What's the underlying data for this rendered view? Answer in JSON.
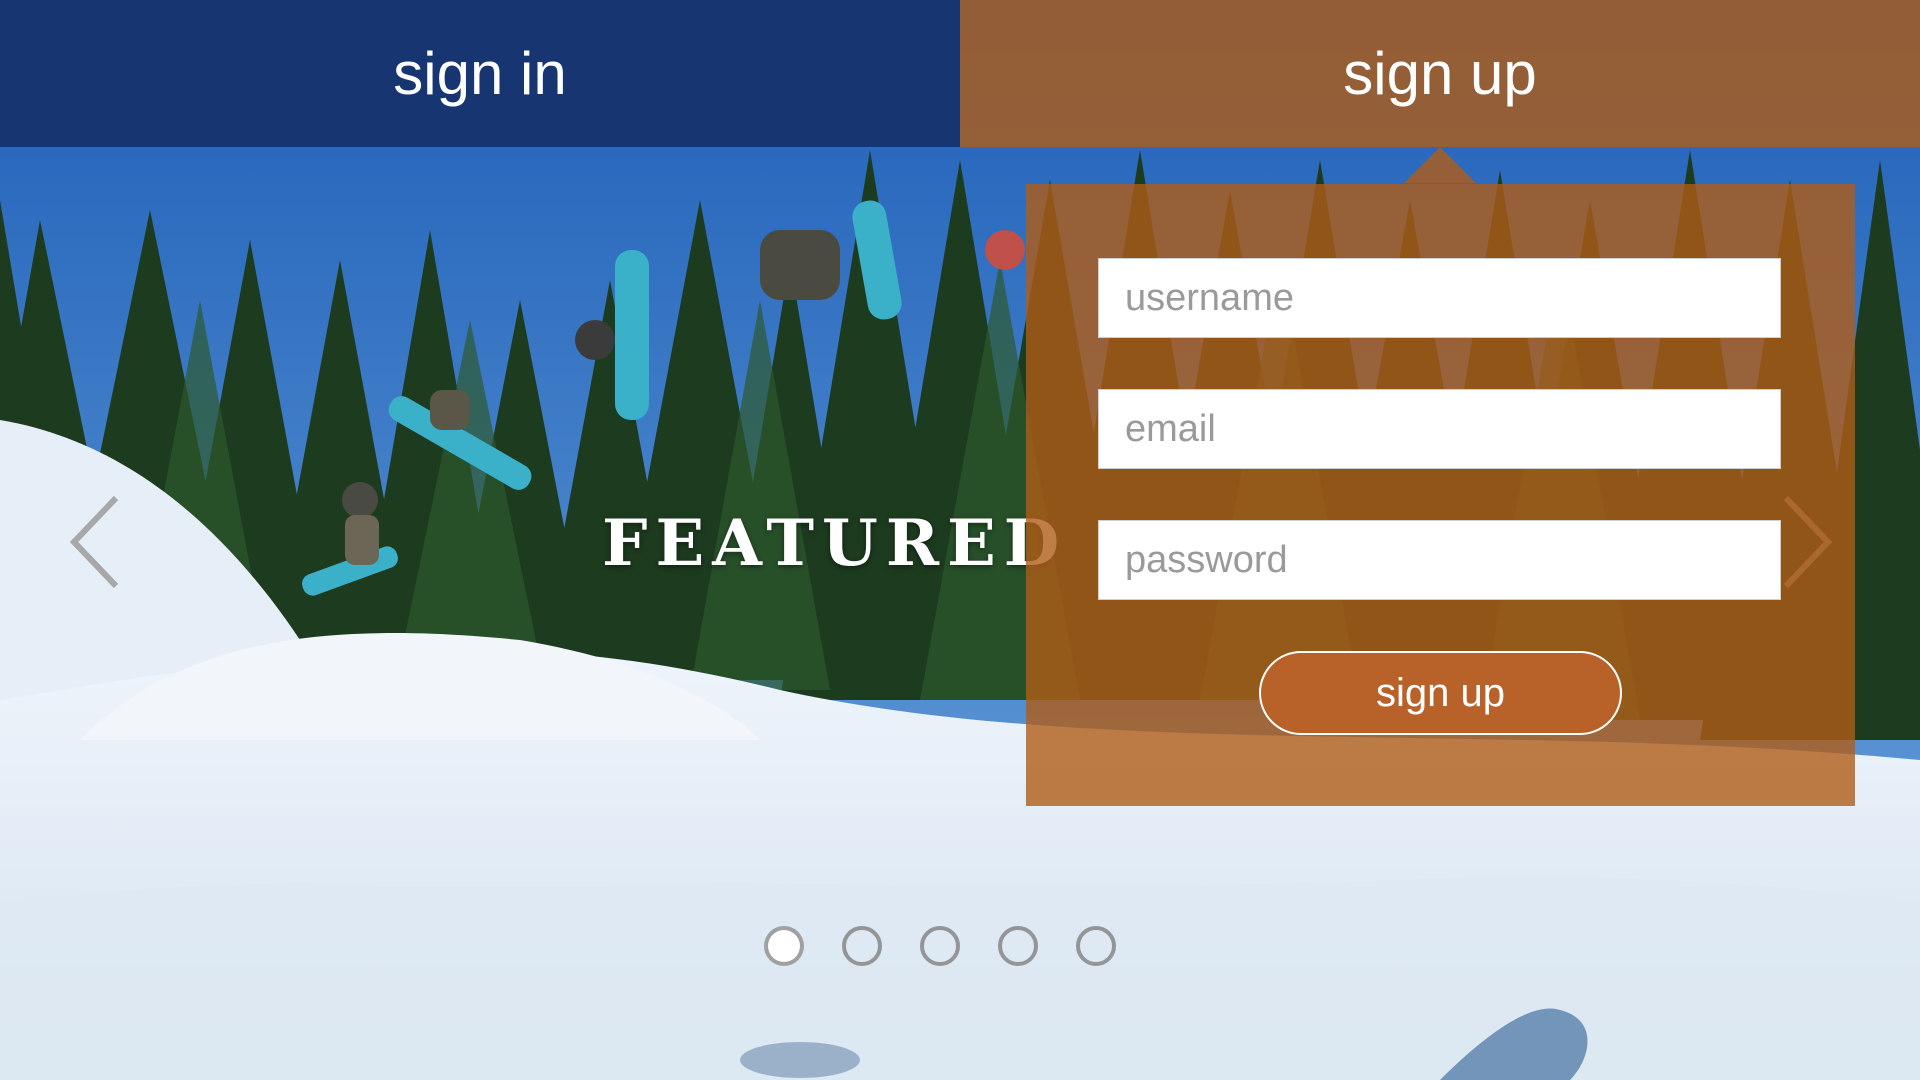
{
  "tabs": {
    "sign_in": "sign in",
    "sign_up": "sign up"
  },
  "slider": {
    "caption": "FEATURED",
    "slide_count": 5,
    "active_slide": 1,
    "prev_icon": "chevron-left-icon",
    "next_icon": "chevron-right-icon"
  },
  "signup_form": {
    "username_placeholder": "username",
    "email_placeholder": "email",
    "password_placeholder": "password",
    "submit_label": "sign up"
  },
  "colors": {
    "sign_in_tab": "#173671",
    "sign_up_accent": "#b05c16",
    "button": "#b8622a"
  }
}
